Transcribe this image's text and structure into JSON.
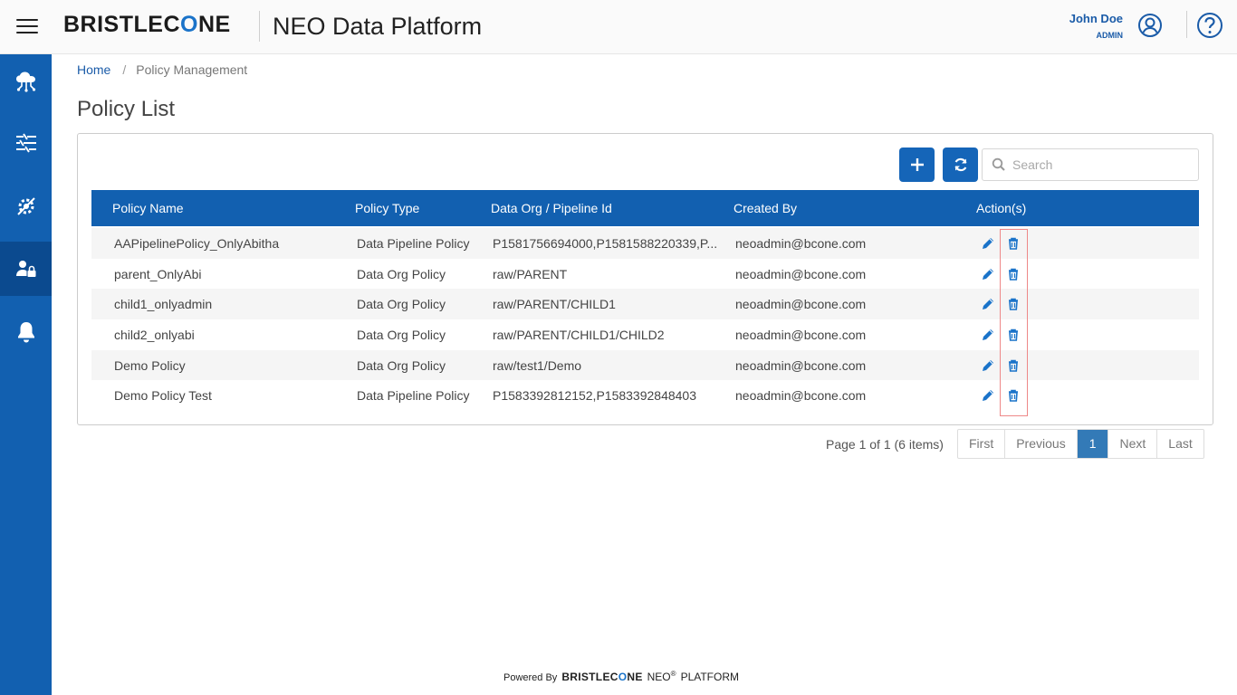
{
  "header": {
    "brand_prefix": "BRISTLEC",
    "brand_o": "O",
    "brand_suffix": "NE",
    "app_title": "NEO Data Platform",
    "user_name": "John Doe",
    "user_role": "ADMIN"
  },
  "sidebar": {
    "items": [
      {
        "icon": "cloud-network-icon"
      },
      {
        "icon": "pipeline-icon"
      },
      {
        "icon": "settings-gear-icon"
      },
      {
        "icon": "user-lock-icon",
        "active": true
      },
      {
        "icon": "bell-icon"
      }
    ]
  },
  "breadcrumb": {
    "home": "Home",
    "separator": "/",
    "current": "Policy Management"
  },
  "page_title": "Policy List",
  "search": {
    "placeholder": "Search",
    "value": ""
  },
  "table": {
    "columns": [
      "Policy Name",
      "Policy Type",
      "Data Org / Pipeline Id",
      "Created By",
      "Action(s)"
    ],
    "rows": [
      {
        "name": "AAPipelinePolicy_OnlyAbitha",
        "type": "Data Pipeline Policy",
        "org": "P1581756694000,P1581588220339,P...",
        "created_by": "neoadmin@bcone.com"
      },
      {
        "name": "parent_OnlyAbi",
        "type": "Data Org Policy",
        "org": "raw/PARENT",
        "created_by": "neoadmin@bcone.com"
      },
      {
        "name": "child1_onlyadmin",
        "type": "Data Org Policy",
        "org": "raw/PARENT/CHILD1",
        "created_by": "neoadmin@bcone.com"
      },
      {
        "name": "child2_onlyabi",
        "type": "Data Org Policy",
        "org": "raw/PARENT/CHILD1/CHILD2",
        "created_by": "neoadmin@bcone.com"
      },
      {
        "name": "Demo Policy",
        "type": "Data Org Policy",
        "org": "raw/test1/Demo",
        "created_by": "neoadmin@bcone.com"
      },
      {
        "name": "Demo Policy Test",
        "type": "Data Pipeline Policy",
        "org": "P1583392812152,P1583392848403",
        "created_by": "neoadmin@bcone.com"
      }
    ]
  },
  "pagination": {
    "info": "Page 1 of 1 (6 items)",
    "first": "First",
    "previous": "Previous",
    "current": "1",
    "next": "Next",
    "last": "Last"
  },
  "footer": {
    "powered_by": "Powered By",
    "brand_prefix": "BRISTLEC",
    "brand_o": "O",
    "brand_suffix": "NE",
    "neo": "NEO",
    "reg": "®",
    "platform": "PLATFORM"
  },
  "colors": {
    "primary": "#1260b0",
    "sidebar_active": "#0b4a8f",
    "link": "#1a5ba8",
    "icon_blue": "#1a73c9"
  }
}
